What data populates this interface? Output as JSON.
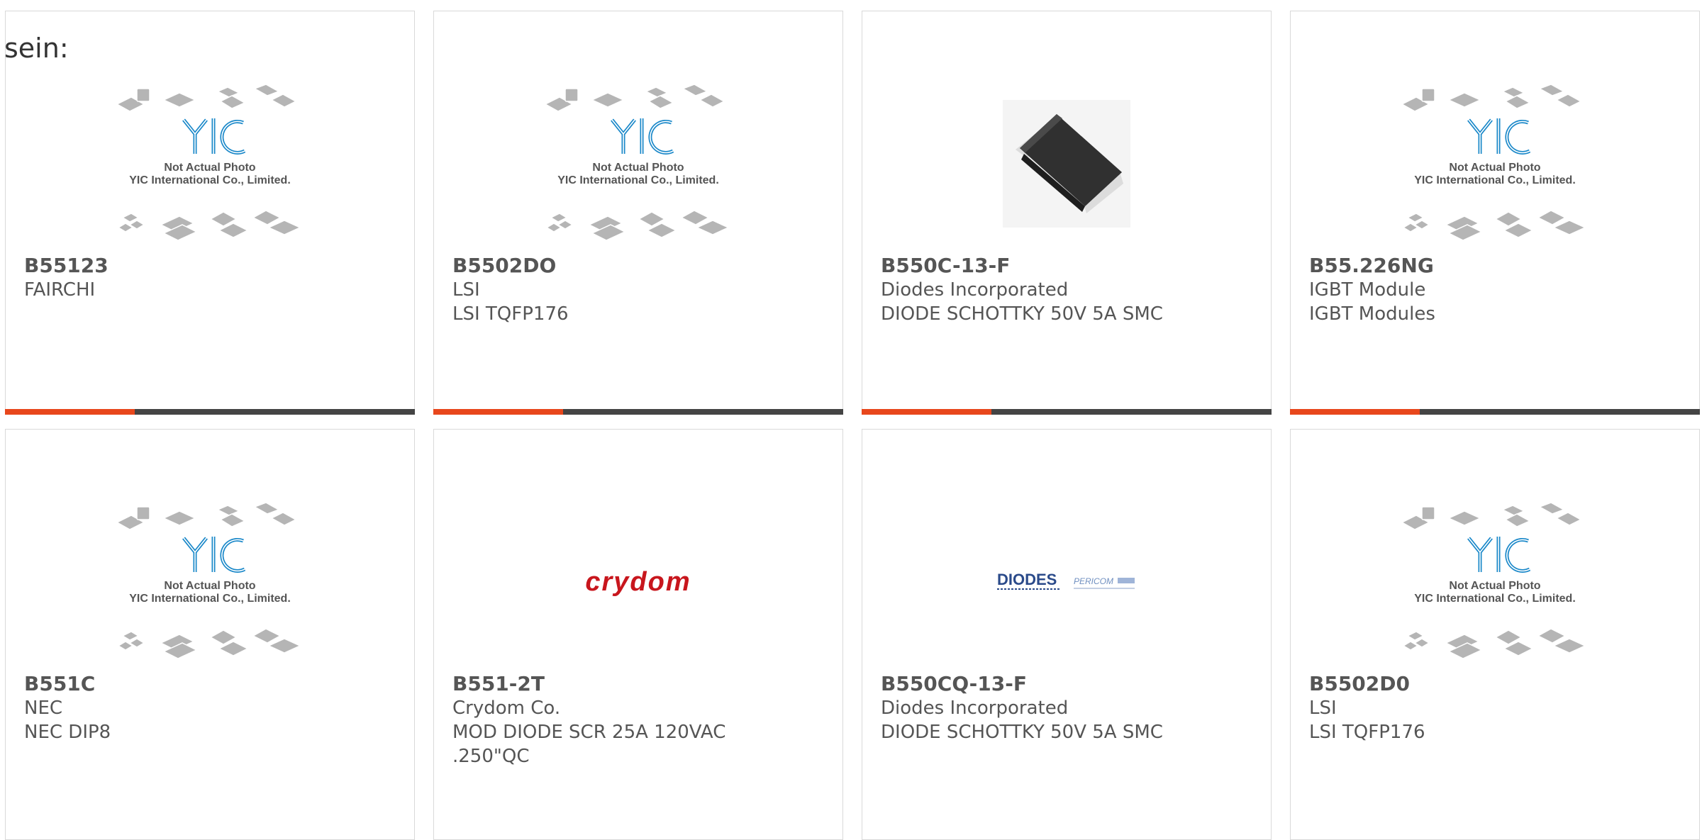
{
  "header": {
    "prefix": "sein:"
  },
  "placeholder": {
    "line1": "Not Actual Photo",
    "line2": "YIC International Co., Limited.",
    "logo": "YIC"
  },
  "brands": {
    "crydom": "crydom",
    "diodes": "DIODES",
    "pericom": "PERICOM"
  },
  "products": [
    {
      "part": "B55123",
      "mfr": "FAIRCHI",
      "desc": "",
      "image": "placeholder"
    },
    {
      "part": "B5502DO",
      "mfr": "LSI",
      "desc": "LSI TQFP176",
      "image": "placeholder"
    },
    {
      "part": "B550C-13-F",
      "mfr": "Diodes Incorporated",
      "desc": "DIODE SCHOTTKY 50V 5A SMC",
      "image": "smc-diode-photo"
    },
    {
      "part": "B55.226NG",
      "mfr": "IGBT Module",
      "desc": "IGBT Modules",
      "image": "placeholder"
    },
    {
      "part": "B551C",
      "mfr": "NEC",
      "desc": "NEC DIP8",
      "image": "placeholder"
    },
    {
      "part": "B551-2T",
      "mfr": "Crydom Co.",
      "desc": "MOD DIODE SCR 25A 120VAC",
      "desc2": ".250\"QC",
      "image": "crydom-logo"
    },
    {
      "part": "B550CQ-13-F",
      "mfr": "Diodes Incorporated",
      "desc": "DIODE SCHOTTKY 50V 5A SMC",
      "image": "diodes-pericom-logo"
    },
    {
      "part": "B5502D0",
      "mfr": "LSI",
      "desc": "LSI TQFP176",
      "image": "placeholder"
    }
  ],
  "colors": {
    "accent": "#e8471c",
    "bar": "#444444",
    "logo": "#1a88c9",
    "crydom": "#c8161d"
  }
}
